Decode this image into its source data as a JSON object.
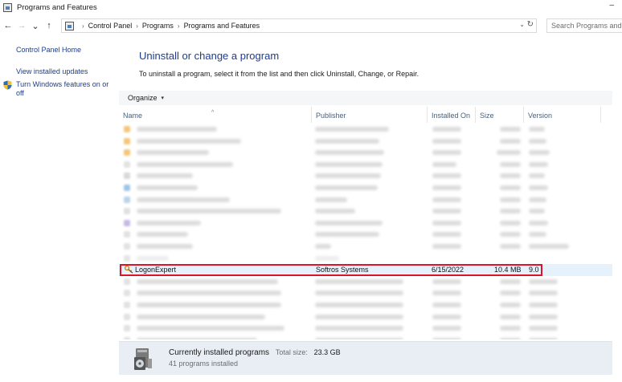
{
  "window": {
    "title": "Programs and Features",
    "minimize": "–"
  },
  "nav": {
    "back": "←",
    "forward": "→",
    "recent": "⌄",
    "up": "↑"
  },
  "address": {
    "crumbs": [
      "Control Panel",
      "Programs",
      "Programs and Features"
    ],
    "separator": "›",
    "dropdown": "⌄",
    "refresh": "↻"
  },
  "search": {
    "placeholder": "Search Programs and Features"
  },
  "sidebar": {
    "home": "Control Panel Home",
    "updates": "View installed updates",
    "features": "Turn Windows features on or off"
  },
  "main": {
    "title": "Uninstall or change a program",
    "description": "To uninstall a program, select it from the list and then click Uninstall, Change, or Repair."
  },
  "toolbar": {
    "organize": "Organize",
    "caret": "▾"
  },
  "table": {
    "sort_caret": "^",
    "columns": [
      "Name",
      "Publisher",
      "Installed On",
      "Size",
      "Version"
    ],
    "selected_row": {
      "name": "LogonExpert",
      "publisher": "Softros Systems",
      "installed_on": "6/15/2022",
      "size": "10.4 MB",
      "version": "9.0"
    }
  },
  "status": {
    "title": "Currently installed programs",
    "total_label": "Total size:",
    "total_value": "23.3 GB",
    "count": "41 programs installed"
  },
  "colors": {
    "link": "#1e3c8c",
    "highlight_border": "#d9142b",
    "selected_row": "#e5f1fb",
    "status_bg": "#e9eef4"
  }
}
